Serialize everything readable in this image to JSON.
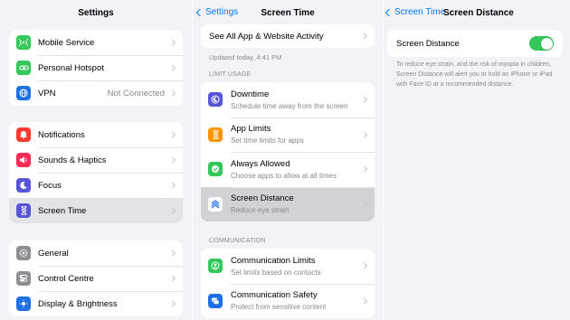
{
  "settings": {
    "title": "Settings",
    "group1": [
      {
        "label": "Mobile Service",
        "icon": "antenna-icon",
        "color": "#34c759",
        "value": ""
      },
      {
        "label": "Personal Hotspot",
        "icon": "link-icon",
        "color": "#34c759",
        "value": ""
      },
      {
        "label": "VPN",
        "icon": "globe-icon",
        "color": "#1f6fe5",
        "value": "Not Connected"
      }
    ],
    "group2": [
      {
        "label": "Notifications",
        "icon": "bell-icon",
        "color": "#ff3b30"
      },
      {
        "label": "Sounds & Haptics",
        "icon": "speaker-icon",
        "color": "#ff2d55"
      },
      {
        "label": "Focus",
        "icon": "moon-icon",
        "color": "#5856d6"
      },
      {
        "label": "Screen Time",
        "icon": "hourglass-icon",
        "color": "#5856d6",
        "selected": true
      }
    ],
    "group3": [
      {
        "label": "General",
        "icon": "gear-icon",
        "color": "#8e8e93"
      },
      {
        "label": "Control Centre",
        "icon": "switches-icon",
        "color": "#8e8e93"
      },
      {
        "label": "Display & Brightness",
        "icon": "sun-icon",
        "color": "#1f6fe5"
      }
    ]
  },
  "screentime": {
    "back": "Settings",
    "title": "Screen Time",
    "see_all": "See All App & Website Activity",
    "updated": "Updated today, 4:41 PM",
    "limit_header": "LIMIT USAGE",
    "limit_items": [
      {
        "title": "Downtime",
        "subtitle": "Schedule time away from the screen",
        "icon": "downtime-icon",
        "color": "#5856d6"
      },
      {
        "title": "App Limits",
        "subtitle": "Set time limits for apps",
        "icon": "hourglass-icon",
        "color": "#ff9500"
      },
      {
        "title": "Always Allowed",
        "subtitle": "Choose apps to allow at all times",
        "icon": "checkmark-icon",
        "color": "#34c759"
      },
      {
        "title": "Screen Distance",
        "subtitle": "Reduce eye strain",
        "icon": "chevrons-up-icon",
        "color": "#1f6fe5",
        "selected": true
      }
    ],
    "comm_header": "COMMUNICATION",
    "comm_items": [
      {
        "title": "Communication Limits",
        "subtitle": "Set limits based on contacts",
        "icon": "person-icon",
        "color": "#34c759"
      },
      {
        "title": "Communication Safety",
        "subtitle": "Protect from sensitive content",
        "icon": "message-icon",
        "color": "#1f6fe5"
      }
    ]
  },
  "distance": {
    "back": "Screen Time",
    "title": "Screen Distance",
    "toggle_label": "Screen Distance",
    "toggle_on": true,
    "description": "To reduce eye strain, and the risk of myopia in children, Screen Distance will alert you to hold an iPhone or iPad with Face ID at a recommended distance."
  }
}
